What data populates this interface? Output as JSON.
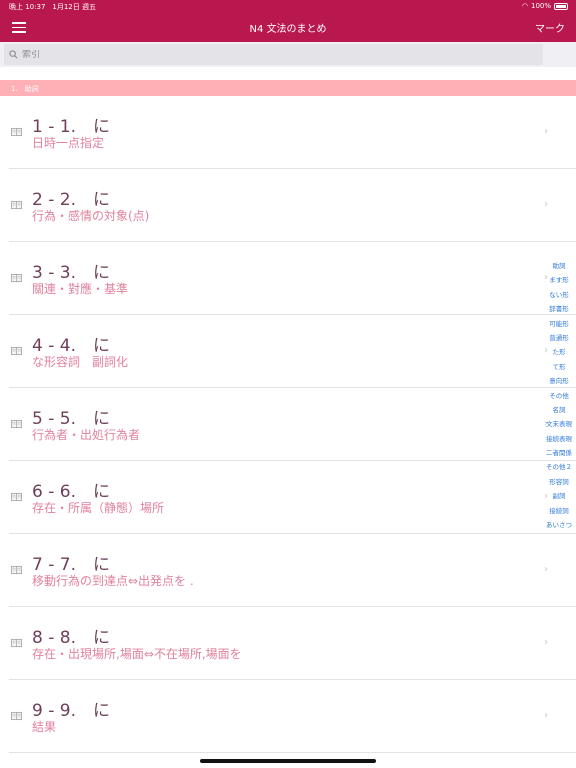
{
  "status": {
    "time_date": "晩上 10:37　1月12日 週五",
    "battery": "100%"
  },
  "nav": {
    "title": "N4 文法のまとめ",
    "mark": "マーク"
  },
  "search": {
    "placeholder": "索引"
  },
  "section": {
    "label": "1.　助詞"
  },
  "items": [
    {
      "title": "1 - 1.　に",
      "subtitle": "日時一点指定"
    },
    {
      "title": "2 - 2.　に",
      "subtitle": "行為・感情の対象(点)"
    },
    {
      "title": "3 - 3.　に",
      "subtitle": "關連・對應・基準"
    },
    {
      "title": "4 - 4.　に",
      "subtitle": "な形容詞　副詞化"
    },
    {
      "title": "5 - 5.　に",
      "subtitle": "行為者・出処行為者"
    },
    {
      "title": "6 - 6.　に",
      "subtitle": "存在・所属（静態）場所"
    },
    {
      "title": "7 - 7.　に",
      "subtitle": "移動行為の到達点⇔出発点を ."
    },
    {
      "title": "8 - 8.　に",
      "subtitle": "存在・出現場所,場面⇔不在場所,場面を"
    },
    {
      "title": "9 - 9.　に",
      "subtitle": "結果"
    }
  ],
  "index": [
    "助詞",
    "ます形",
    "ない形",
    "辞書形",
    "可能形",
    "普通形",
    "た形",
    "て形",
    "意向形",
    "その他",
    "名詞",
    "文末表現",
    "接続表現",
    "二者関係",
    "その他２",
    "形容詞",
    "副詞",
    "接続詞",
    "あいさつ"
  ],
  "colors": {
    "accent": "#b9184e",
    "section": "#ffb0b6",
    "title": "#6f3f59",
    "subtitle": "#e0829c",
    "index": "#2f7ad8"
  },
  "icons": {
    "row": "book-icon",
    "chevron": "chevron-right-icon",
    "search": "search-icon",
    "menu": "hamburger-menu-icon"
  }
}
